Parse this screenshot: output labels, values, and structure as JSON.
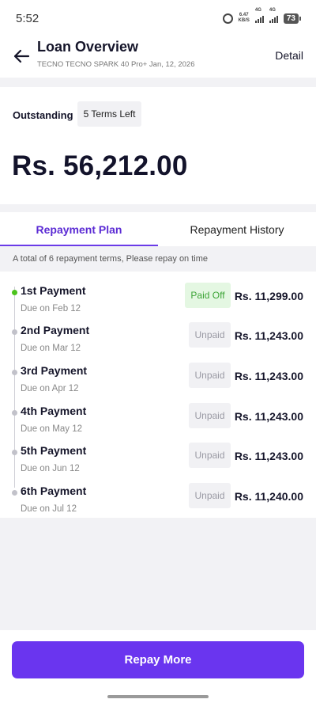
{
  "status_bar": {
    "time": "5:52",
    "net_speed_value": "6.47",
    "net_speed_unit": "KB/S",
    "signal1_label": "4G",
    "signal2_label": "4G",
    "battery": "73"
  },
  "header": {
    "title": "Loan Overview",
    "subtitle": "TECNO TECNO SPARK 40 Pro+ Jan, 12, 2026",
    "detail_label": "Detail"
  },
  "summary": {
    "outstanding_label": "Outstanding",
    "terms_left": "5 Terms Left",
    "amount": "Rs. 56,212.00"
  },
  "tabs": [
    {
      "label": "Repayment Plan",
      "active": true
    },
    {
      "label": "Repayment History",
      "active": false
    }
  ],
  "plan_info": "A total of 6 repayment terms, Please repay on time",
  "payments": [
    {
      "title": "1st Payment",
      "due": "Due on Feb 12",
      "status": "Paid Off",
      "amount": "Rs. 11,299.00"
    },
    {
      "title": "2nd Payment",
      "due": "Due on Mar 12",
      "status": "Unpaid",
      "amount": "Rs. 11,243.00"
    },
    {
      "title": "3rd Payment",
      "due": "Due on Apr 12",
      "status": "Unpaid",
      "amount": "Rs. 11,243.00"
    },
    {
      "title": "4th Payment",
      "due": "Due on May 12",
      "status": "Unpaid",
      "amount": "Rs. 11,243.00"
    },
    {
      "title": "5th Payment",
      "due": "Due on Jun 12",
      "status": "Unpaid",
      "amount": "Rs. 11,243.00"
    },
    {
      "title": "6th Payment",
      "due": "Due on Jul 12",
      "status": "Unpaid",
      "amount": "Rs. 11,240.00"
    }
  ],
  "actions": {
    "repay_more_label": "Repay More"
  },
  "colors": {
    "accent": "#6a35ef",
    "paid_green": "#3ca436",
    "paid_bg": "#e4f7e2"
  }
}
